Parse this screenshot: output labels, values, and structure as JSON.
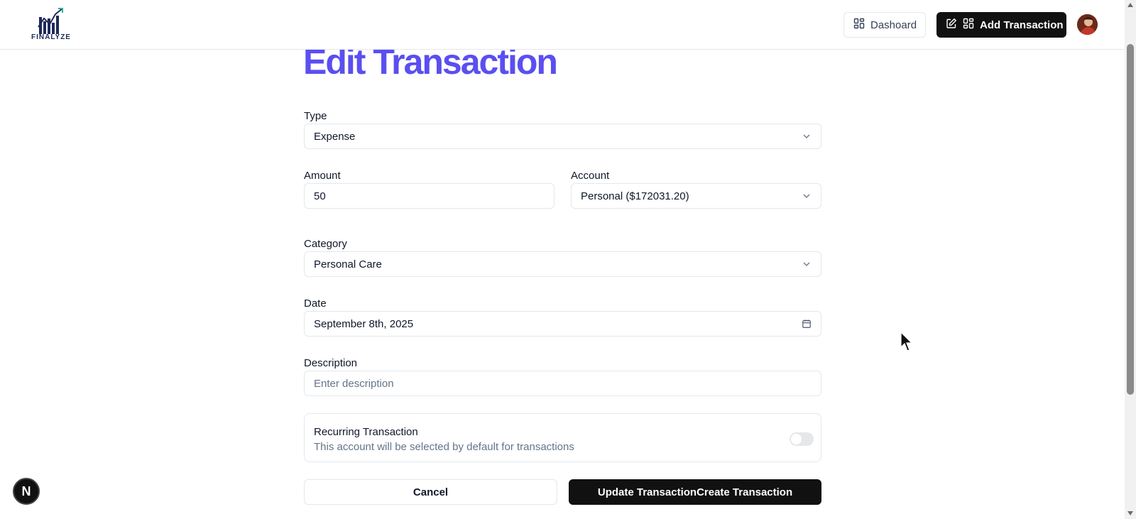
{
  "header": {
    "logo_text": "FINALYZE",
    "dashboard_label": "Dashoard",
    "add_transaction_label": "Add Transaction"
  },
  "form": {
    "title": "Edit Transaction",
    "type": {
      "label": "Type",
      "value": "Expense"
    },
    "amount": {
      "label": "Amount",
      "value": "50"
    },
    "account": {
      "label": "Account",
      "value": "Personal ($172031.20)"
    },
    "category": {
      "label": "Category",
      "value": "Personal Care"
    },
    "date": {
      "label": "Date",
      "value": "September 8th, 2025"
    },
    "description": {
      "label": "Description",
      "placeholder": "Enter description",
      "value": ""
    },
    "recurring": {
      "title": "Recurring Transaction",
      "description": "This account will be selected by default for transactions",
      "enabled": false
    },
    "cancel_label": "Cancel",
    "submit_label": "Update TransactionCreate Transaction"
  },
  "next_badge": "N",
  "icons": {
    "dashboard": "layout-dashboard-icon",
    "edit": "pen-square-icon",
    "chevron": "chevron-down-icon",
    "calendar": "calendar-icon"
  },
  "colors": {
    "title": "#5a4ff0",
    "primary_button": "#111111",
    "border": "#e2e8f0"
  }
}
